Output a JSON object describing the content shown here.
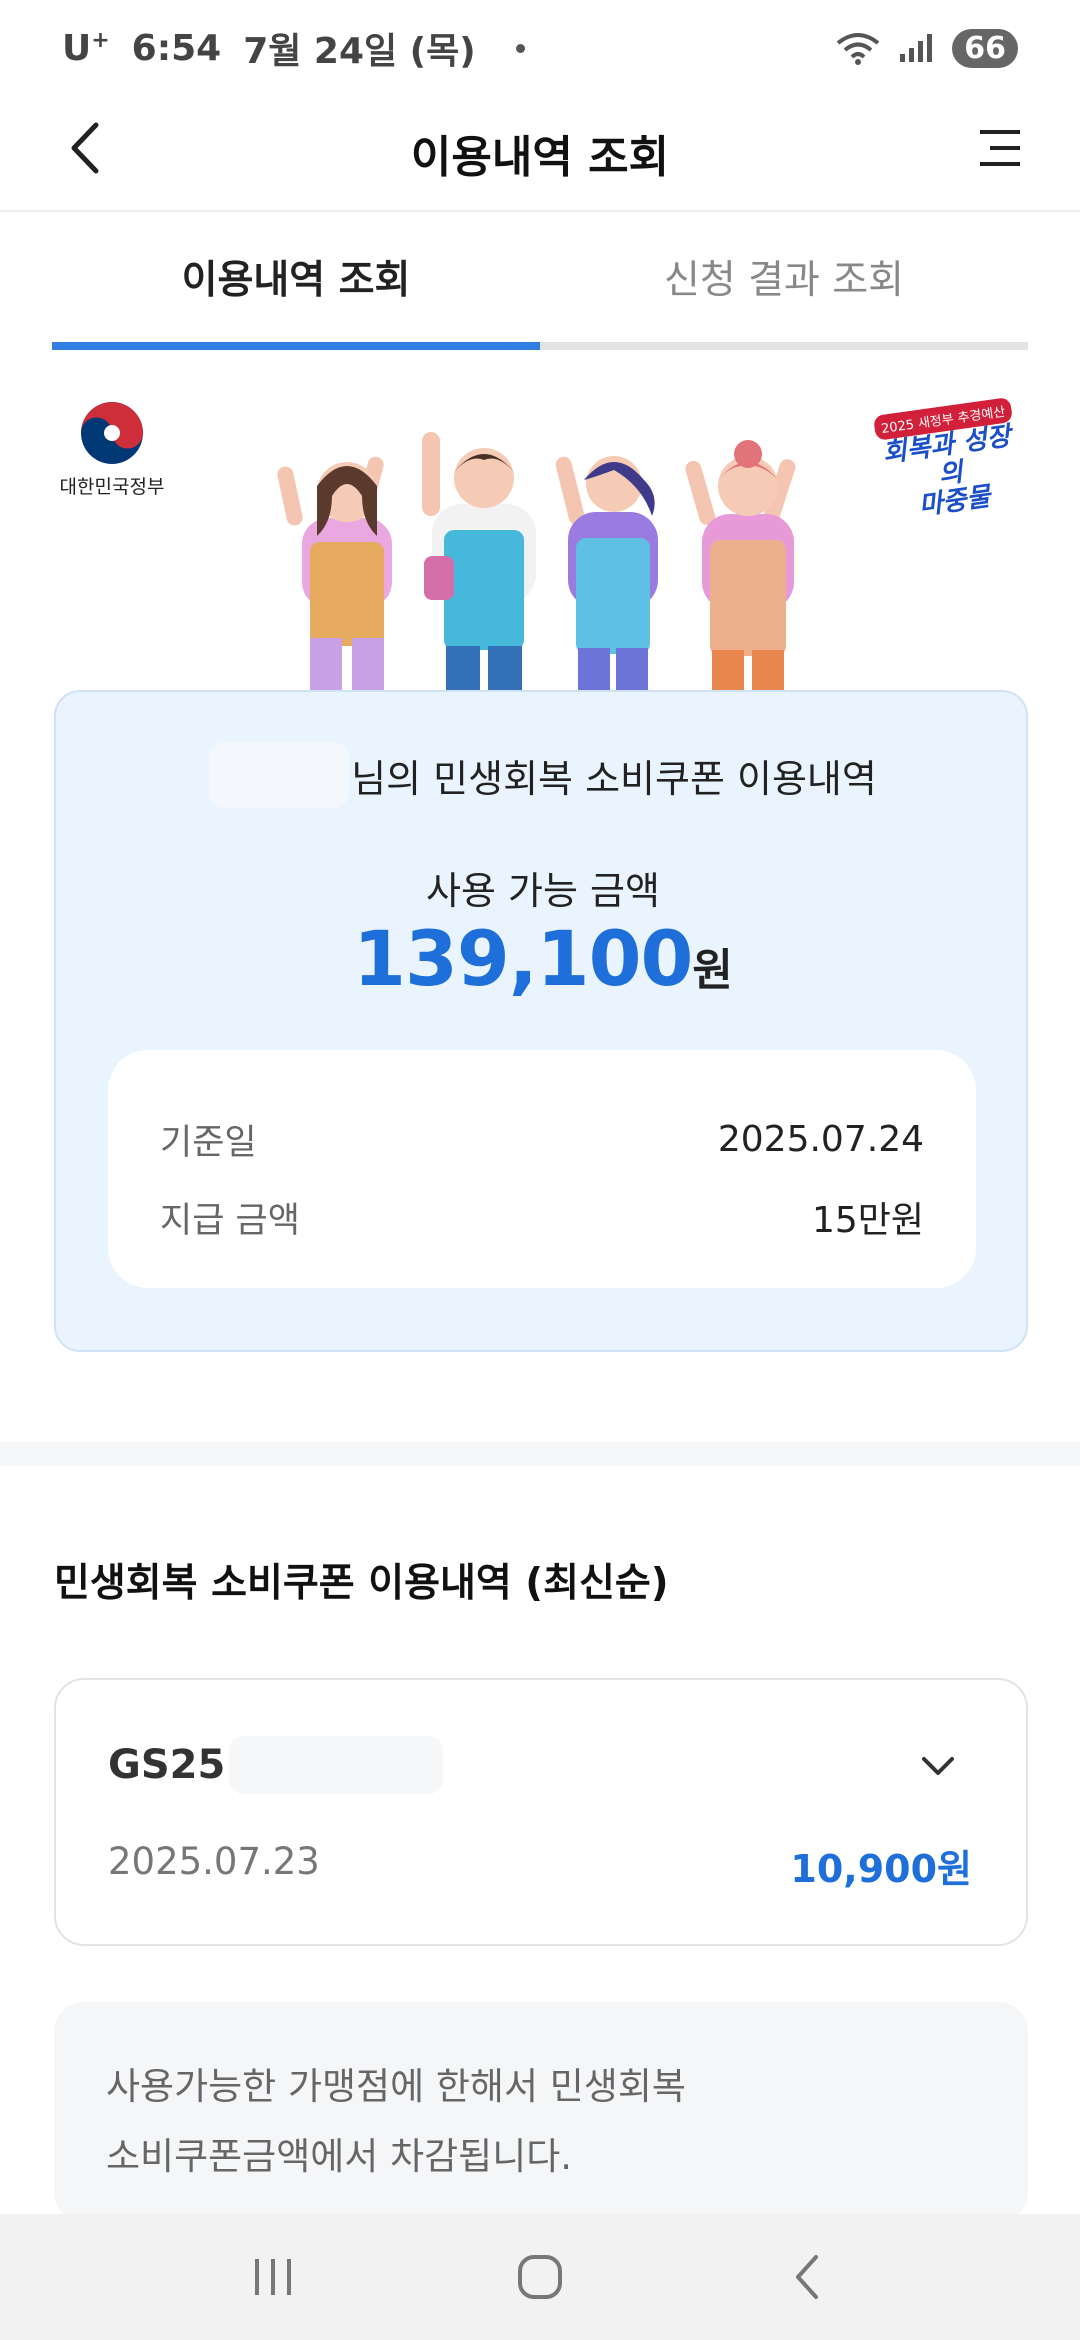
{
  "status_bar": {
    "carrier": "U",
    "carrier_sup": "+",
    "time": "6:54",
    "date": "7월 24일 (목)",
    "battery": "66"
  },
  "header": {
    "title": "이용내역 조회"
  },
  "tabs": [
    {
      "label": "이용내역 조회",
      "active": true
    },
    {
      "label": "신청 결과 조회",
      "active": false
    }
  ],
  "banner": {
    "gov_label": "대한민국정부",
    "campaign_small": "2025 새정부 추경예산",
    "campaign_main_1": "회복과 성장의",
    "campaign_main_2": "마중물"
  },
  "summary": {
    "owner_suffix": "님의 민생회복 소비쿠폰 이용내역",
    "available_label": "사용 가능 금액",
    "available_amount": "139,100",
    "available_unit": "원",
    "rows": [
      {
        "label": "기준일",
        "value": "2025.07.24"
      },
      {
        "label": "지급 금액",
        "value": "15만원"
      }
    ]
  },
  "history": {
    "title": "민생회복 소비쿠폰 이용내역 (최신순)",
    "items": [
      {
        "store": "GS25",
        "date": "2025.07.23",
        "amount": "10,900원"
      }
    ]
  },
  "notice": {
    "line1": "사용가능한 가맹점에 한해서 민생회복",
    "line2": "소비쿠폰금액에서 차감됩니다."
  },
  "colors": {
    "accent": "#1e6fd9",
    "tab_indicator": "#2f80e0",
    "card_bg": "#eaf4fe"
  },
  "icons": {
    "back": "chevron-left-icon",
    "menu": "menu-icon",
    "expand": "chevron-down-icon"
  }
}
